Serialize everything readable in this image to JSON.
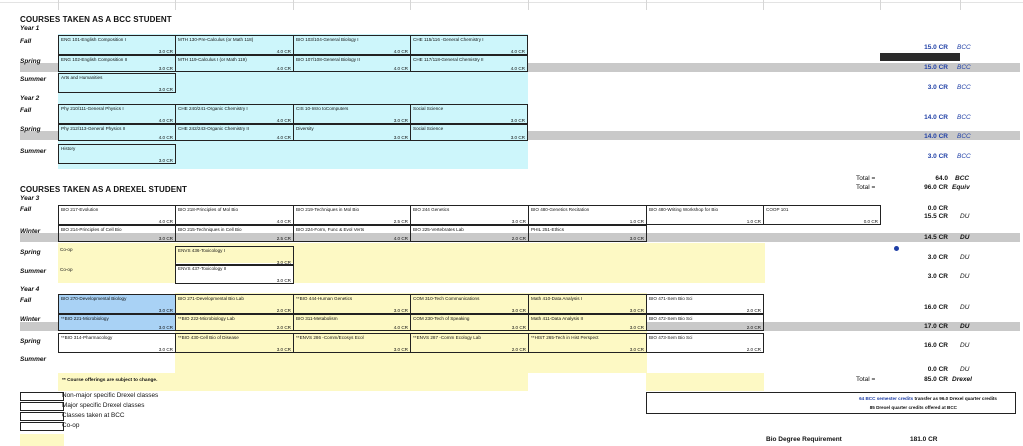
{
  "bcc": {
    "title": "COURSES TAKEN AS A BCC STUDENT",
    "year1": "Year 1",
    "year2": "Year 2",
    "rows": [
      {
        "term": "Fall",
        "cells": [
          {
            "name": "ENG 101-English Composition I",
            "cr": "3.0 CR"
          },
          {
            "name": "MTH 130-Pre-Calculus (or Math 118)",
            "cr": "4.0 CR"
          },
          {
            "name": "BIO 103/104-General Biology I",
            "cr": "4.0 CR"
          },
          {
            "name": "CHE 115/116 -General Chemistry I",
            "cr": "4.0 CR"
          }
        ],
        "total": "15.0 CR",
        "tag": "BCC"
      },
      {
        "term": "Spring",
        "cells": [
          {
            "name": "ENG 102-English Composition II",
            "cr": "3.0 CR"
          },
          {
            "name": "MTH 119-Calculus I (or Math 119)",
            "cr": "4.0 CR"
          },
          {
            "name": "BIO 107/108-General Biology II",
            "cr": "4.0 CR"
          },
          {
            "name": "CHE 117/118-General Chemistry II",
            "cr": "4.0 CR"
          }
        ],
        "total": "15.0 CR",
        "tag": "BCC"
      },
      {
        "term": "Summer",
        "cells": [
          {
            "name": "Arts and Humanities",
            "cr": "3.0 CR"
          }
        ],
        "total": "3.0 CR",
        "tag": "BCC"
      },
      {
        "term": "Fall",
        "cells": [
          {
            "name": "Phy 210/111-General Physics I",
            "cr": "4.0 CR"
          },
          {
            "name": "CHE 240/241-Organic Chemistry I",
            "cr": "4.0 CR"
          },
          {
            "name": "CIS 10-Intro toComputers",
            "cr": "3.0 CR"
          },
          {
            "name": "Social Science",
            "cr": "3.0 CR"
          }
        ],
        "total": "14.0 CR",
        "tag": "BCC"
      },
      {
        "term": "Spring",
        "cells": [
          {
            "name": "Phy 212/113-General Physics II",
            "cr": "4.0 CR"
          },
          {
            "name": "CHE 242/243-Organic Chemistry II",
            "cr": "4.0 CR"
          },
          {
            "name": "Diversity",
            "cr": "3.0 CR"
          },
          {
            "name": "Social Science",
            "cr": "3.0 CR"
          }
        ],
        "total": "14.0 CR",
        "tag": "BCC"
      },
      {
        "term": "Summer",
        "cells": [
          {
            "name": "History",
            "cr": "3.0 CR"
          }
        ],
        "total": "3.0 CR",
        "tag": "BCC"
      }
    ],
    "total_label": "Total =",
    "total_value": "64.0",
    "total_tag": "BCC",
    "total_label2": "Total =",
    "total_value2": "96.0 CR",
    "total_tag2": "Equiv"
  },
  "drexel": {
    "title": "COURSES TAKEN AS A DREXEL STUDENT",
    "year3": "Year 3",
    "year4": "Year 4",
    "rows": [
      {
        "term": "Fall",
        "cells": [
          {
            "name": "BIO 217-Evolution",
            "cr": "4.0 CR"
          },
          {
            "name": "BIO 218-Principles of Mol Bio",
            "cr": "4.0 CR"
          },
          {
            "name": "BIO 219-Techniques in Mol Bio",
            "cr": "2.5 CR"
          },
          {
            "name": "BIO 244 Genetics",
            "cr": "3.0 CR"
          },
          {
            "name": "BIO 480-Genetics Recitation",
            "cr": "1.0 CR"
          },
          {
            "name": "BIO 480-Writing Workshop for Bio",
            "cr": "1.0 CR"
          },
          {
            "name": "COOP 101",
            "cr": "0.0 CR"
          }
        ],
        "total": "0.0 CR",
        "total2": "15.5 CR",
        "tag": "DU"
      },
      {
        "term": "Winter",
        "cells": [
          {
            "name": "BIO 214-Principles of Cell Bio",
            "cr": "3.0 CR"
          },
          {
            "name": "BIO 215-Techniques in Cell Bio",
            "cr": "2.5 CR"
          },
          {
            "name": "BIO 224-Form, Func & Evol Verts",
            "cr": "4.0 CR"
          },
          {
            "name": "BIO 225-Vertebrates Lab",
            "cr": "2.0 CR"
          },
          {
            "name": "PHIL 251-Ethics",
            "cr": "3.0 CR"
          }
        ],
        "total": "14.5 CR",
        "tag": "DU"
      },
      {
        "term": "Spring",
        "cells": [
          {
            "name": "Co-op",
            "cr": ""
          },
          {
            "name": "ENVS 436-Toxicology I",
            "cr": "3.0 CR"
          }
        ],
        "total": "3.0 CR",
        "tag": "DU"
      },
      {
        "term": "Summer",
        "cells": [
          {
            "name": "Co-op",
            "cr": ""
          },
          {
            "name": "ENVS 437-Toxicology II",
            "cr": "3.0 CR"
          }
        ],
        "total": "3.0 CR",
        "tag": "DU"
      },
      {
        "term": "Fall",
        "cells": [
          {
            "name": "BIO 270-Developmental Biology",
            "cr": "3.0 CR"
          },
          {
            "name": "BIO 271-Developmental Bio Lab",
            "cr": "2.0 CR"
          },
          {
            "name": "**BIO 444-Human Genetics",
            "cr": "3.0 CR"
          },
          {
            "name": "COM 310-Tech Communications",
            "cr": "3.0 CR"
          },
          {
            "name": "Math 410-Data Analysis I",
            "cr": "3.0 CR"
          },
          {
            "name": "BIO 471-Sem Bio Sci",
            "cr": "2.0 CR"
          }
        ],
        "total": "16.0 CR",
        "tag": "DU"
      },
      {
        "term": "Winter",
        "cells": [
          {
            "name": "**BIO 221-Microbiology",
            "cr": "3.0 CR"
          },
          {
            "name": "**BIO 222-Microbiology Lab",
            "cr": "2.0 CR"
          },
          {
            "name": "BIO 311-Metabolism",
            "cr": "4.0 CR"
          },
          {
            "name": "COM 230-Tech of Speaking",
            "cr": "3.0 CR"
          },
          {
            "name": "Math 411-Data Analysis II",
            "cr": "3.0 CR"
          },
          {
            "name": "BIO 472-Sem Bio Sci",
            "cr": "2.0 CR"
          }
        ],
        "total": "17.0 CR",
        "tag": "DU"
      },
      {
        "term": "Spring",
        "cells": [
          {
            "name": "**BIO 314-Pharmacology",
            "cr": "3.0 CR"
          },
          {
            "name": "**BIO 430-Cell Bio of Disease",
            "cr": "3.0 CR"
          },
          {
            "name": "**ENVS 286 -Comm/Ecosys Ecol",
            "cr": "3.0 CR"
          },
          {
            "name": "**ENVS 287 -Comm Ecology Lab",
            "cr": "2.0 CR"
          },
          {
            "name": "**HIST 265-Tech in Hist Perspect",
            "cr": "3.0 CR"
          },
          {
            "name": "BIO 473-Sem Bio Sci",
            "cr": "2.0 CR"
          }
        ],
        "total": "16.0 CR",
        "tag": "DU"
      },
      {
        "term": "Summer",
        "cells": [],
        "total": "0.0 CR",
        "tag": "DU"
      }
    ],
    "note": "** Course offerings are subject to change.",
    "total_label": "Total =",
    "total_value": "85.0 CR",
    "total_tag": "Drexel"
  },
  "legend": [
    "Non-major specific Drexel classes",
    "Major specific Drexel classes",
    "Classes taken at BCC",
    "Co-op"
  ],
  "transfer": {
    "line1_bold": "64  BCC semester credits",
    "line1_rest": "transfer as 96.0  Drexel quarter credits",
    "line2": "85  Drexel quarter credits offered at BCC"
  },
  "requirement": {
    "label": "Bio Degree Requirement",
    "value": "181.0 CR"
  },
  "colors": {
    "cyan": "#cdf6fb",
    "yellow": "#fdf9c4",
    "blue_fill": "#a9d2f5",
    "band_gray": "#c9c9c9",
    "blue_text": "#1f3fa6"
  }
}
